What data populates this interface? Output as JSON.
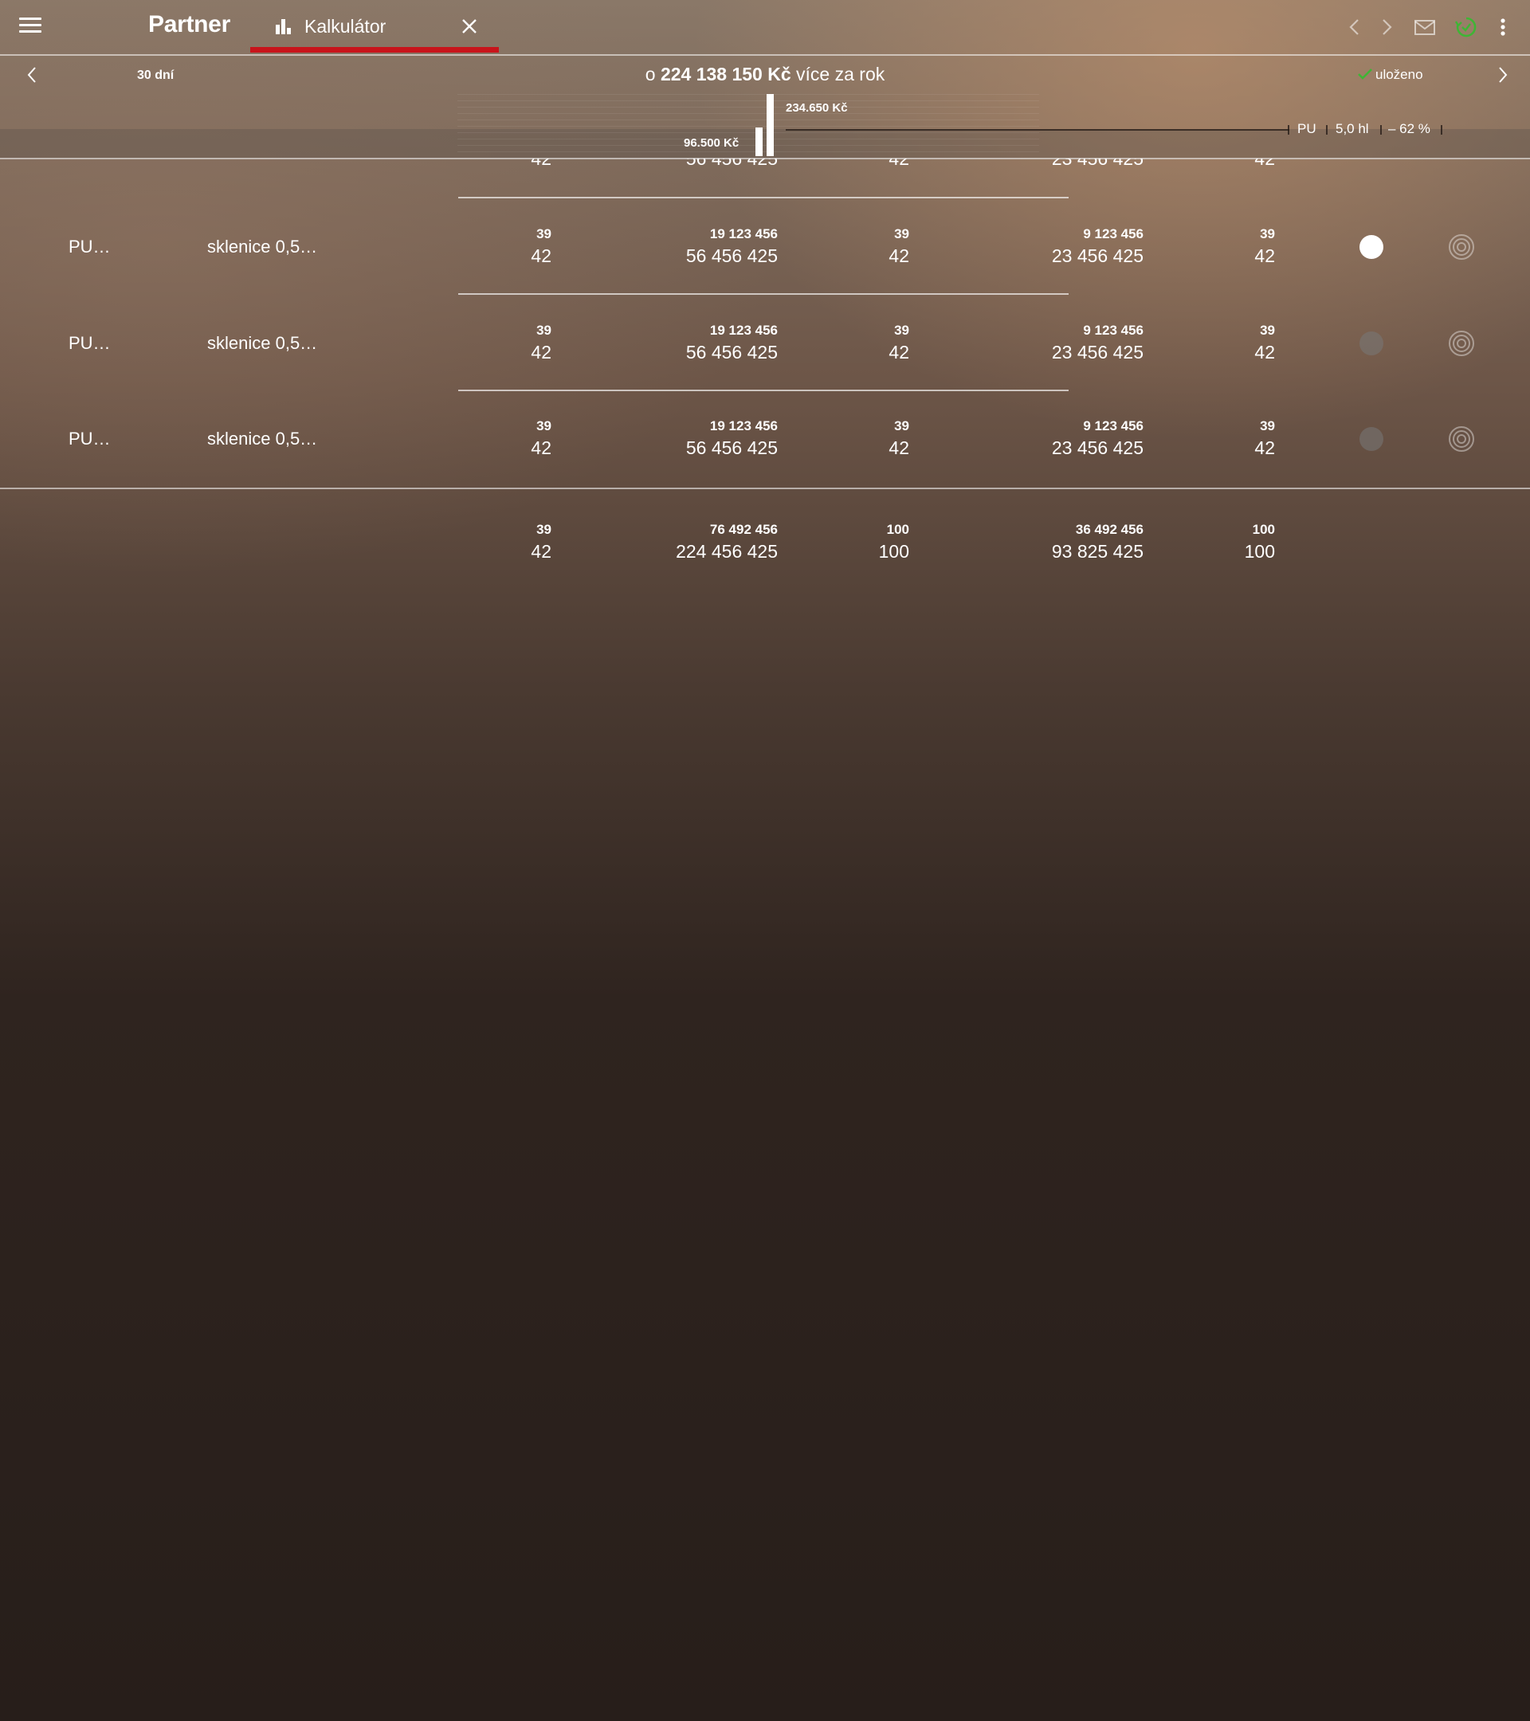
{
  "app": {
    "title": "Partner"
  },
  "tab": {
    "label": "Kalkulátor",
    "icon": "bar-chart-icon"
  },
  "header_icons": [
    "back-icon",
    "forward-icon",
    "mail-icon",
    "sync-icon",
    "more-vert-icon"
  ],
  "summary": {
    "period": "30 dní",
    "prefix": "o",
    "amount": "224 138 150 Kč",
    "suffix": "více za rok",
    "status": "uloženo"
  },
  "compare": {
    "old_value": "96.500 Kč",
    "new_value": "234.650 Kč",
    "product": "PU",
    "volume": "5,0 hl",
    "change": "– 62 %"
  },
  "partial_row": {
    "c1": "42",
    "c2": "56 456 425",
    "c3": "42",
    "c4": "23 456 425",
    "c5": "42"
  },
  "rows": [
    {
      "name": "PU…",
      "package": "sklenice 0,5…",
      "c1_small": "39",
      "c1_big": "42",
      "c2_small": "19 123 456",
      "c2_big": "56 456 425",
      "c3_small": "39",
      "c3_big": "42",
      "c4_small": "9 123 456",
      "c4_big": "23 456 425",
      "c5_small": "39",
      "c5_big": "42",
      "toggle": true
    },
    {
      "name": "PU…",
      "package": "sklenice 0,5…",
      "c1_small": "39",
      "c1_big": "42",
      "c2_small": "19 123 456",
      "c2_big": "56 456 425",
      "c3_small": "39",
      "c3_big": "42",
      "c4_small": "9 123 456",
      "c4_big": "23 456 425",
      "c5_small": "39",
      "c5_big": "42",
      "toggle": false
    },
    {
      "name": "PU…",
      "package": "sklenice 0,5…",
      "c1_small": "39",
      "c1_big": "42",
      "c2_small": "19 123 456",
      "c2_big": "56 456 425",
      "c3_small": "39",
      "c3_big": "42",
      "c4_small": "9 123 456",
      "c4_big": "23 456 425",
      "c5_small": "39",
      "c5_big": "42",
      "toggle": false
    }
  ],
  "totals": {
    "c1_small": "39",
    "c1_big": "42",
    "c2_small": "76 492 456",
    "c2_big": "224 456 425",
    "c3_small": "100",
    "c3_big": "100",
    "c4_small": "36 492 456",
    "c4_big": "93 825 425",
    "c5_small": "100",
    "c5_big": "100"
  },
  "colors": {
    "accent": "#c8141b",
    "saved_check": "#3fb535"
  }
}
